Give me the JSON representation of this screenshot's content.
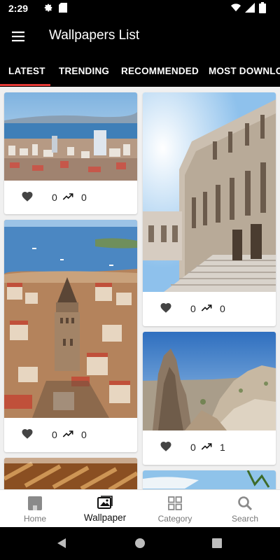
{
  "status_bar": {
    "time": "2:29"
  },
  "app_bar": {
    "title": "Wallpapers List"
  },
  "tabs": [
    {
      "label": "LATEST",
      "active": true
    },
    {
      "label": "TRENDING"
    },
    {
      "label": "RECOMMENDED"
    },
    {
      "label": "MOST DOWNLOADED"
    }
  ],
  "wallpapers": [
    {
      "scene": "city-bay-skyline",
      "likes": "0",
      "views": "0"
    },
    {
      "scene": "ornate-palace",
      "likes": "0",
      "views": "0"
    },
    {
      "scene": "stone-tower-city",
      "likes": "0",
      "views": "0"
    },
    {
      "scene": "rock-formations",
      "likes": "0",
      "views": "1"
    },
    {
      "scene": "pastry-closeup"
    },
    {
      "scene": "coast-sky"
    }
  ],
  "bottom_nav": [
    {
      "label": "Home",
      "icon": "home-icon"
    },
    {
      "label": "Wallpaper",
      "icon": "wallpaper-icon",
      "active": true
    },
    {
      "label": "Category",
      "icon": "grid-icon"
    },
    {
      "label": "Search",
      "icon": "search-icon"
    }
  ],
  "colors": {
    "accent": "#e53935",
    "app_bar": "#000000",
    "background": "#f0f0f0"
  }
}
